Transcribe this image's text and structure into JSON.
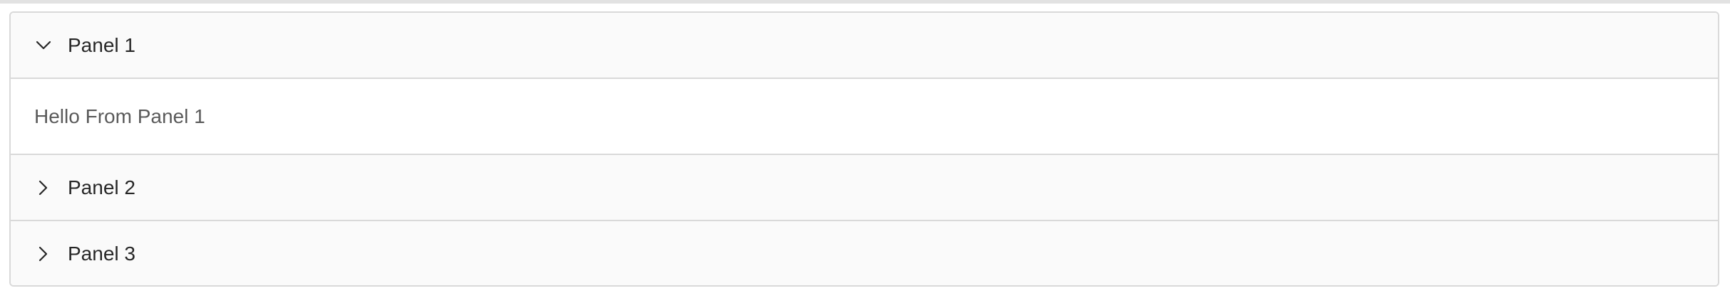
{
  "collapse": {
    "panels": [
      {
        "title": "Panel 1",
        "expanded": true,
        "arrow_icon": "chevron-down-icon",
        "content": "Hello From Panel 1"
      },
      {
        "title": "Panel 2",
        "expanded": false,
        "arrow_icon": "chevron-right-icon"
      },
      {
        "title": "Panel 3",
        "expanded": false,
        "arrow_icon": "chevron-right-icon"
      }
    ]
  },
  "colors": {
    "header_bg": "#fafafa",
    "content_bg": "#ffffff",
    "border": "#d9d9d9",
    "title_text": "#262626",
    "content_text": "#595959"
  }
}
